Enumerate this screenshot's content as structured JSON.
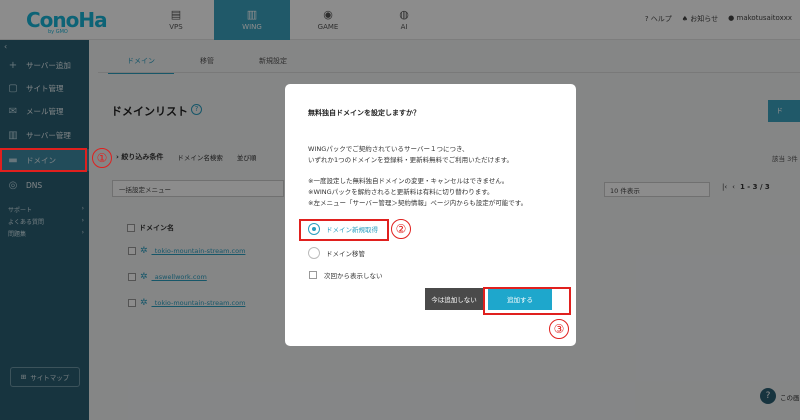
{
  "header": {
    "logo": "ConoHa",
    "logo_sub": "by GMO",
    "nav": [
      {
        "label": "VPS",
        "icon": "server-icon"
      },
      {
        "label": "WING",
        "icon": "wing-icon"
      },
      {
        "label": "GAME",
        "icon": "gamepad-icon"
      },
      {
        "label": "AI",
        "icon": "ai-icon"
      }
    ],
    "help": "ヘルプ",
    "notice": "お知らせ",
    "user": "makotusaitoxxx"
  },
  "sidebar": {
    "items": [
      {
        "label": "サーバー追加"
      },
      {
        "label": "サイト管理"
      },
      {
        "label": "メール管理"
      },
      {
        "label": "サーバー管理"
      },
      {
        "label": "ドメイン"
      },
      {
        "label": "DNS"
      }
    ],
    "sub": [
      {
        "label": "サポート"
      },
      {
        "label": "よくある質問"
      },
      {
        "label": "問題集"
      }
    ],
    "sitemap": "サイトマップ"
  },
  "main": {
    "tabs": [
      {
        "label": "ドメイン"
      },
      {
        "label": "移管"
      },
      {
        "label": "新規設定"
      }
    ],
    "page_title": "ドメインリスト",
    "help_mark": "?",
    "add_button": "ド",
    "filter_title": "絞り込み条件",
    "filter_items": [
      "ドメイン名検索",
      "並び順"
    ],
    "count": "該当 3件",
    "bulk_select": "一括設定メニュー",
    "per_page": "10 件表示",
    "pager": "1 - 3 / 3",
    "column_header": "ドメイン名",
    "domains": [
      "_tokio-mountain-stream.com",
      "_aswellwork.com",
      "_tokio-mountain-stream.com"
    ],
    "help_bubble": "?",
    "help_bubble_text": "この画"
  },
  "modal": {
    "title": "無料独自ドメインを設定しますか？",
    "lines_1": [
      "WINGパックでご契約されているサーバー１つにつき、",
      "いずれか1つのドメインを登録料・更新料無料でご利用いただけます。"
    ],
    "lines_2": [
      "※一度設定した無料独自ドメインの変更・キャンセルはできません。",
      "※WINGパックを解約されると更新料は有料に切り替わります。",
      "※左メニュー「サーバー管理＞契約情報」ページ内からも設定が可能です。"
    ],
    "option_new": "ドメイン新規取得",
    "option_transfer": "ドメイン移管",
    "dont_show": "次回から表示しない",
    "btn_not_now": "今は追加しない",
    "btn_add": "追加する"
  },
  "annotations": {
    "n1": "①",
    "n2": "②",
    "n3": "③"
  },
  "colors": {
    "accent": "#1ea7cc",
    "sidebar": "#2b5f73",
    "annotation_red": "#e0201e"
  }
}
